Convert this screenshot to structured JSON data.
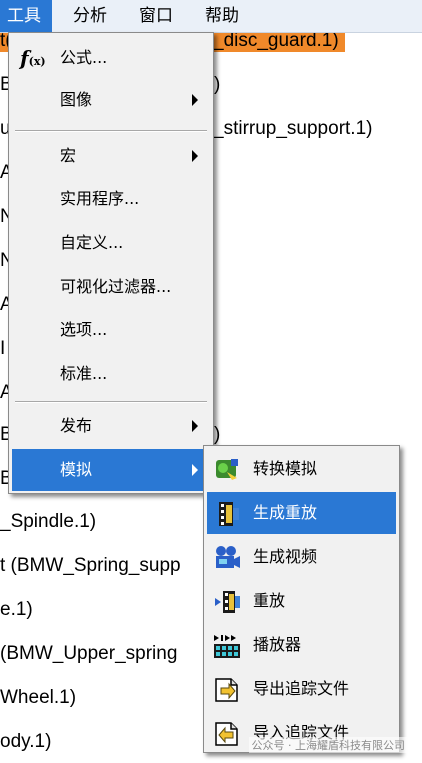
{
  "menubar": {
    "items": [
      {
        "label": "工具",
        "active": true
      },
      {
        "label": "分析",
        "active": false
      },
      {
        "label": "窗口",
        "active": false
      },
      {
        "label": "帮助",
        "active": false
      }
    ]
  },
  "background_tree": [
    {
      "text": "t(",
      "right": "_disc_guard.1)"
    },
    {
      "text": "B",
      "right": ")"
    },
    {
      "text": "u",
      "right": "_stirrup_support.1)"
    },
    {
      "text": "A"
    },
    {
      "text": "N"
    },
    {
      "text": "N"
    },
    {
      "text": "A"
    },
    {
      "text": "I"
    },
    {
      "text": "A"
    },
    {
      "text": "B",
      "right": ")"
    },
    {
      "text": "B"
    },
    {
      "text": "_Spindle.1)"
    },
    {
      "text": "t (BMW_Spring_supp"
    },
    {
      "text": "e.1)"
    },
    {
      "text": "(BMW_Upper_spring"
    },
    {
      "text": "Wheel.1)"
    },
    {
      "text": "ody.1)"
    }
  ],
  "tools_menu": {
    "formula": {
      "icon_text": "f",
      "icon_sub": "(x)",
      "label": "公式..."
    },
    "image": "图像",
    "macro": "宏",
    "utility": "实用程序...",
    "customize": "自定义...",
    "vis_filter": "可视化过滤器...",
    "options": "选项...",
    "standard": "标准...",
    "publish": "发布",
    "simulate": "模拟"
  },
  "simulate_submenu": {
    "convert": "转换模拟",
    "generate_replay": "生成重放",
    "generate_video": "生成视频",
    "replay": "重放",
    "player": "播放器",
    "export_trace": "导出追踪文件",
    "import_trace": "导入追踪文件"
  },
  "watermark": "公众号 · 上海耀盾科技有限公司",
  "colors": {
    "selection": "#2a78d4",
    "highlight": "#f0892a",
    "menu_bg": "#f1f1f1"
  }
}
